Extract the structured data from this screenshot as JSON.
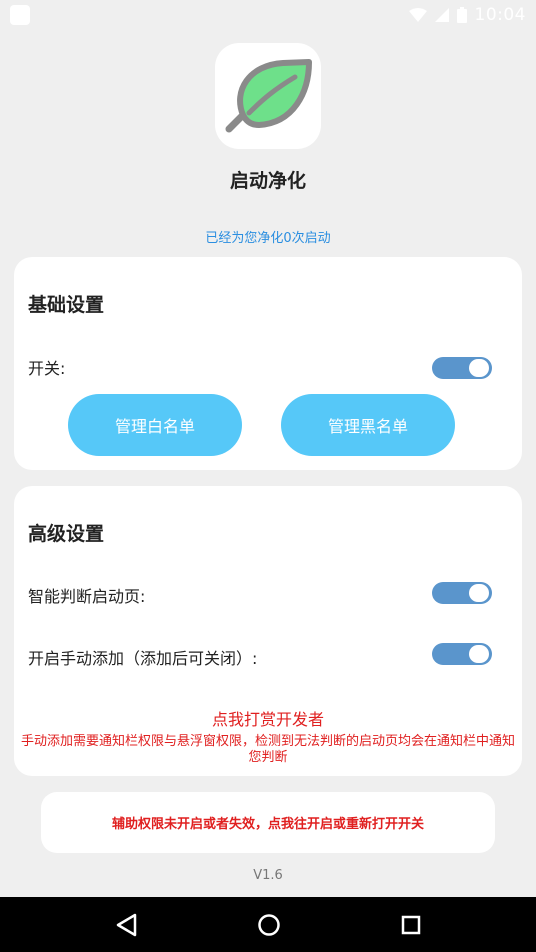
{
  "status_bar": {
    "time": "10:04"
  },
  "app": {
    "title": "启动净化",
    "subtitle": "已经为您净化0次启动"
  },
  "basic_settings": {
    "title": "基础设置",
    "switch_label": "开关:",
    "switch_on": true,
    "whitelist_button": "管理白名单",
    "blacklist_button": "管理黑名单"
  },
  "advanced_settings": {
    "title": "高级设置",
    "smart_detect_label": "智能判断启动页:",
    "smart_detect_on": true,
    "manual_add_label": "开启手动添加（添加后可关闭）:",
    "manual_add_on": true,
    "donate_link": "点我打赏开发者",
    "note": "手动添加需要通知栏权限与悬浮窗权限，检测到无法判断的启动页均会在通知栏中通知您判断"
  },
  "warning": {
    "text": "辅助权限未开启或者失效，点我往开启或重新打开开关"
  },
  "version": "V1.6",
  "colors": {
    "accent_blue": "#2a8ee0",
    "button_blue": "#56c8f8",
    "toggle_blue": "#5a95cc",
    "warning_red": "#e02020",
    "leaf_green": "#6ee08a"
  }
}
